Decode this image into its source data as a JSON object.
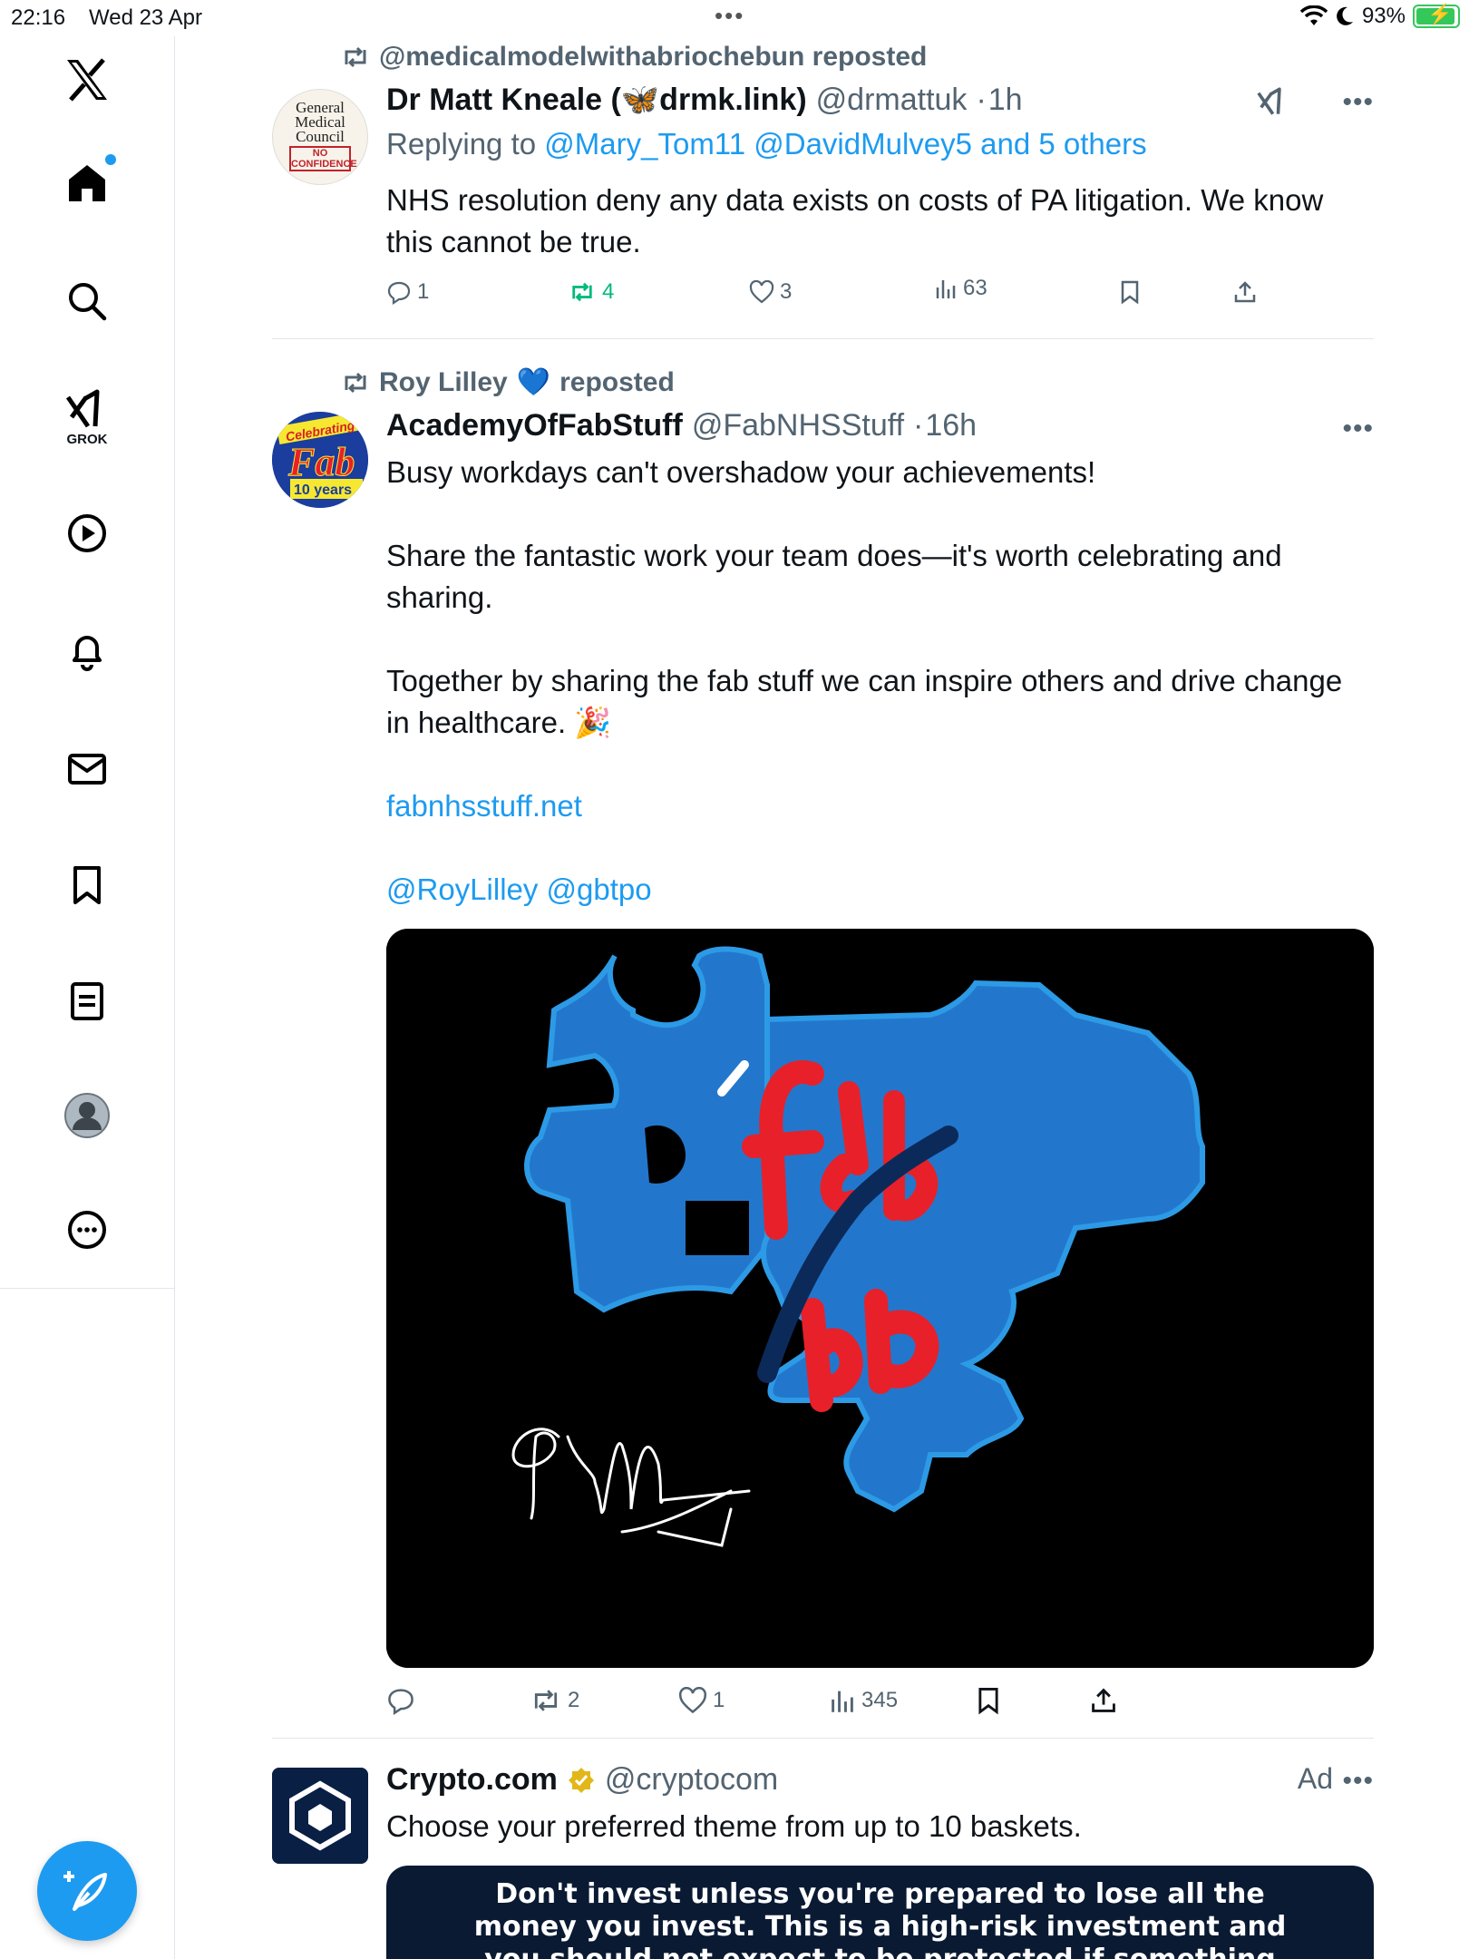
{
  "status_bar": {
    "time": "22:16",
    "date": "Wed 23 Apr",
    "battery": "93%"
  },
  "sidebar": {
    "grok_label": "GROK"
  },
  "tweets": [
    {
      "reposted_by": "@medicalmodelwithabriochebun reposted",
      "name_prefix": "Dr Matt Kneale (",
      "name_suffix": "drmk.link)",
      "handle": "@drmattuk",
      "time": "1h",
      "reply_prefix": "Replying to",
      "reply_to": "@Mary_Tom11 @DavidMulvey5 and 5 others",
      "text": "NHS resolution deny any data exists on costs of PA litigation. We know this cannot be true.",
      "avatar_lines": [
        "General",
        "Medical",
        "Council",
        "NO",
        "CONFIDENCE"
      ],
      "replies": "1",
      "reposts": "4",
      "likes": "3",
      "views": "63"
    },
    {
      "reposted_by_name": "Roy Lilley",
      "reposted_by_suffix": "reposted",
      "name": "AcademyOfFabStuff",
      "handle": "@FabNHSStuff",
      "time": "16h",
      "para1": "Busy workdays can't overshadow your achievements!",
      "para2": "Share the fantastic work your team does—it's worth celebrating and sharing.",
      "para3": "Together by sharing the fab stuff we can inspire others and drive change in healthcare. 🎉",
      "link": "fabnhsstuff.net",
      "mentions": "@RoyLilley @gbtpo",
      "avatar_top": "Celebrating",
      "avatar_mid": "Fab",
      "avatar_bottom": "10 years",
      "replies": "",
      "reposts": "2",
      "likes": "1",
      "views": "345"
    },
    {
      "name": "Crypto.com",
      "handle": "@cryptocom",
      "ad_label": "Ad",
      "text": "Choose your preferred theme from up to 10 baskets.",
      "disclaimer": "Don't invest unless you're prepared to lose all the money you invest. This is a high-risk investment and you should not expect to be protected if something goes wrong."
    }
  ],
  "colors": {
    "accent": "#1d9bf0",
    "repost_green": "#00ba7c",
    "muted": "#536471",
    "puzzle_blue": "#2277cc",
    "fab_red": "#e8202a"
  }
}
